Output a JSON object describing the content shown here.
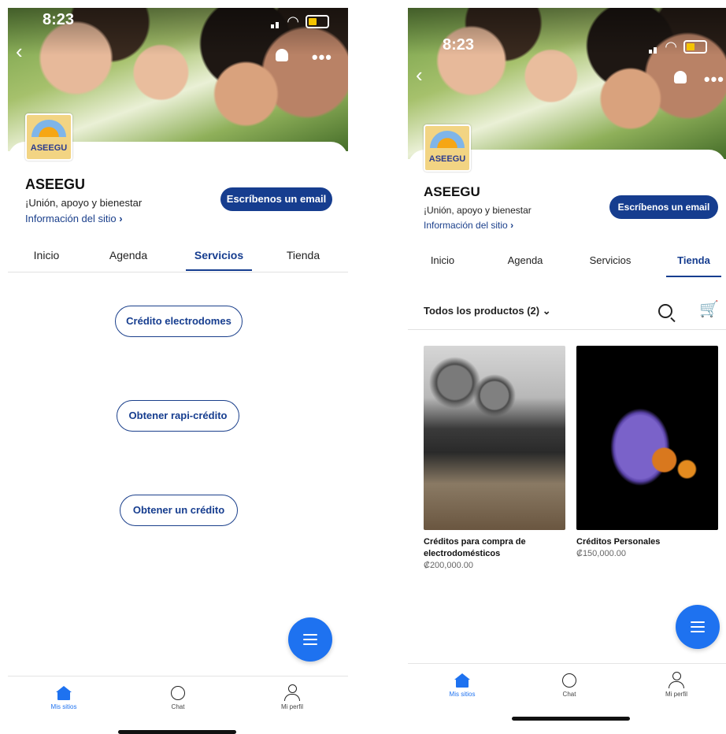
{
  "status": {
    "time": "8:23"
  },
  "site": {
    "name": "ASEEGU",
    "tagline": "¡Unión, apoyo y bienestar",
    "info_link": "Información del sitio",
    "email_button": "Escríbenos un email",
    "logo_text": "ASEEGU"
  },
  "tabs": [
    "Inicio",
    "Agenda",
    "Servicios",
    "Tienda"
  ],
  "screen1": {
    "active_tab": "Servicios",
    "services": [
      "Crédito electrodomes",
      "Obtener rapi-crédito",
      "Obtener un crédito"
    ]
  },
  "screen2": {
    "active_tab": "Tienda",
    "filter_label": "Todos los productos (2)",
    "products": [
      {
        "title": "Créditos para compra de electrodomésticos",
        "price": "₡200,000.00"
      },
      {
        "title": "Créditos Personales",
        "price": "₡150,000.00"
      }
    ]
  },
  "bottom_nav": {
    "home": "Mis sitios",
    "chat": "Chat",
    "profile": "Mi perfil"
  },
  "colors": {
    "brand": "#163d8f",
    "accent": "#1e72f0"
  },
  "icons": [
    "back-icon",
    "bell-icon",
    "more-icon",
    "chevron-right-icon",
    "chevron-down-icon",
    "search-icon",
    "cart-icon",
    "menu-icon",
    "home-icon",
    "chat-icon",
    "user-icon"
  ]
}
